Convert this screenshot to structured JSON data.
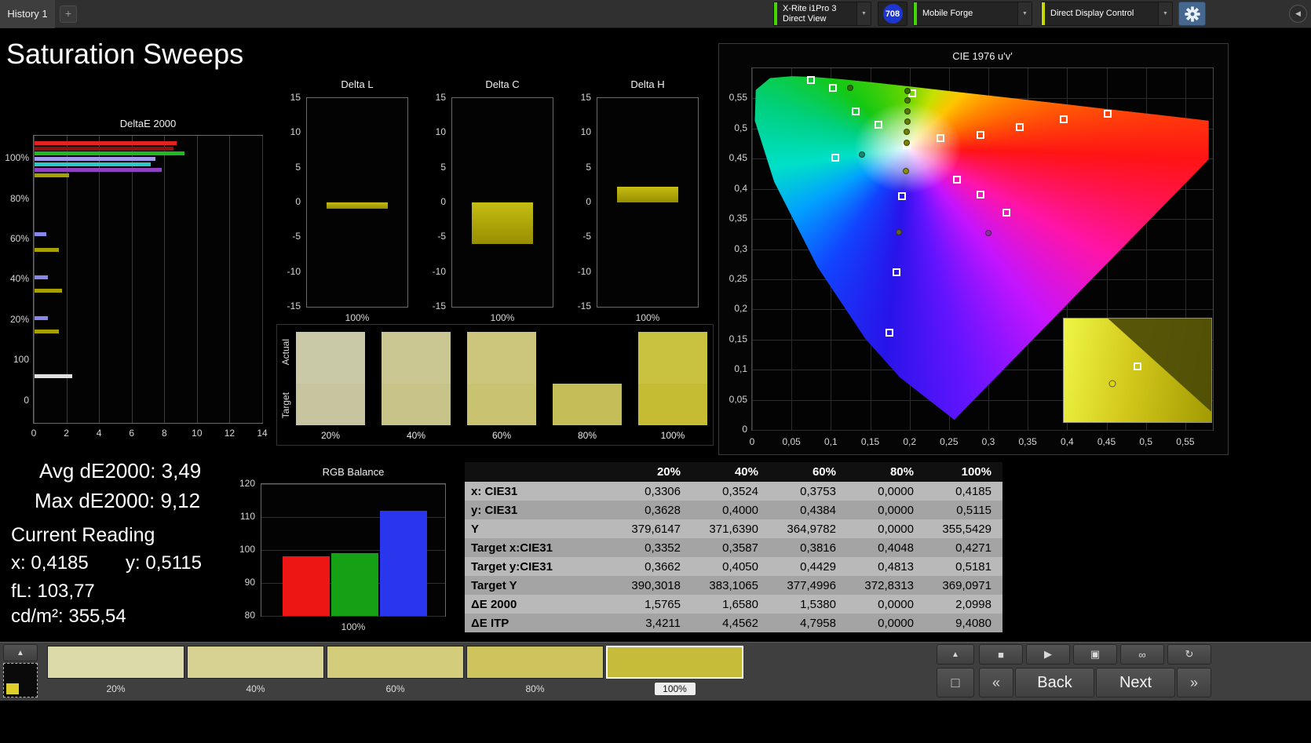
{
  "topbar": {
    "history_tab": "History 1",
    "meter": {
      "line1": "X-Rite i1Pro 3",
      "line2": "Direct View",
      "indicator_color": "#44d600"
    },
    "badge": "708",
    "badge_color": "#1c36cf",
    "source": {
      "label": "Mobile Forge",
      "indicator_color": "#44d600"
    },
    "display_control": {
      "label": "Direct Display Control",
      "indicator_color": "#c6d800"
    }
  },
  "page_title": "Saturation Sweeps",
  "readings": {
    "avg_de2000": {
      "label": "Avg dE2000:",
      "value": "3,49"
    },
    "max_de2000": {
      "label": "Max dE2000:",
      "value": "9,12"
    },
    "current_reading_label": "Current Reading",
    "x": {
      "label": "x:",
      "value": "0,4185"
    },
    "y": {
      "label": "y:",
      "value": "0,5115"
    },
    "fl": {
      "label": "fL:",
      "value": "103,77"
    },
    "cdm2": {
      "label": "cd/m²:",
      "value": "355,54"
    }
  },
  "patches": {
    "row_labels": [
      "Actual",
      "Target"
    ],
    "items": [
      {
        "label": "20%",
        "actual": "#c9c9a8",
        "target": "#c7c5a0"
      },
      {
        "label": "40%",
        "actual": "#cbc792",
        "target": "#c8c389"
      },
      {
        "label": "60%",
        "actual": "#ccc67c",
        "target": "#c9c271"
      },
      {
        "label": "80%",
        "actual": "#000000",
        "target": "#c5bd58"
      },
      {
        "label": "100%",
        "actual": "#c9c240",
        "target": "#c5bc33"
      }
    ]
  },
  "table": {
    "columns": [
      "",
      "20%",
      "40%",
      "60%",
      "80%",
      "100%"
    ],
    "rows": [
      {
        "label": "x: CIE31",
        "values": [
          "0,3306",
          "0,3524",
          "0,3753",
          "0,0000",
          "0,4185"
        ]
      },
      {
        "label": "y: CIE31",
        "values": [
          "0,3628",
          "0,4000",
          "0,4384",
          "0,0000",
          "0,5115"
        ]
      },
      {
        "label": "Y",
        "values": [
          "379,6147",
          "371,6390",
          "364,9782",
          "0,0000",
          "355,5429"
        ]
      },
      {
        "label": "Target x:CIE31",
        "values": [
          "0,3352",
          "0,3587",
          "0,3816",
          "0,4048",
          "0,4271"
        ]
      },
      {
        "label": "Target y:CIE31",
        "values": [
          "0,3662",
          "0,4050",
          "0,4429",
          "0,4813",
          "0,5181"
        ]
      },
      {
        "label": "Target Y",
        "values": [
          "390,3018",
          "383,1065",
          "377,4996",
          "372,8313",
          "369,0971"
        ]
      },
      {
        "label": "ΔE 2000",
        "values": [
          "1,5765",
          "1,6580",
          "1,5380",
          "0,0000",
          "2,0998"
        ]
      },
      {
        "label": "ΔE ITP",
        "values": [
          "3,4211",
          "4,4562",
          "4,7958",
          "0,0000",
          "9,4080"
        ]
      }
    ]
  },
  "bottom_bar": {
    "swatches": [
      {
        "label": "20%",
        "color": "#dcdaa8",
        "selected": false
      },
      {
        "label": "40%",
        "color": "#d7d292",
        "selected": false
      },
      {
        "label": "60%",
        "color": "#d2cc7b",
        "selected": false
      },
      {
        "label": "80%",
        "color": "#cdc45d",
        "selected": false
      },
      {
        "label": "100%",
        "color": "#c6bc3a",
        "selected": true
      }
    ],
    "back_label": "Back",
    "next_label": "Next"
  },
  "icons": {
    "add": "+",
    "chevron": "▼",
    "collapse": "◀",
    "up_arrow": "▲",
    "stop": "■",
    "play": "▶",
    "single_read": "▣",
    "continuous": "∞",
    "repeat": "↻",
    "prev": "«",
    "next": "»",
    "big_stop": "□"
  },
  "chart_data": [
    {
      "id": "deltae2000",
      "type": "bar",
      "orientation": "horizontal",
      "title": "DeltaE 2000",
      "xlim": [
        0,
        14
      ],
      "xticks": [
        0,
        2,
        4,
        6,
        8,
        10,
        12,
        14
      ],
      "ylabels": [
        {
          "text": "100%",
          "pos": 0.079
        },
        {
          "text": "80%",
          "pos": 0.22
        },
        {
          "text": "60%",
          "pos": 0.361
        },
        {
          "text": "40%",
          "pos": 0.5
        },
        {
          "text": "20%",
          "pos": 0.641
        },
        {
          "text": "100",
          "pos": 0.782
        },
        {
          "text": "0",
          "pos": 0.923
        }
      ],
      "bars": [
        {
          "pos": 0.018,
          "value": 8.7,
          "color": "#e42222"
        },
        {
          "pos": 0.037,
          "value": 8.5,
          "color": "#8c1212"
        },
        {
          "pos": 0.056,
          "value": 9.2,
          "color": "#22b822"
        },
        {
          "pos": 0.075,
          "value": 7.4,
          "color": "#a49aec"
        },
        {
          "pos": 0.094,
          "value": 7.1,
          "color": "#2ec8c8"
        },
        {
          "pos": 0.113,
          "value": 7.8,
          "color": "#9040c0"
        },
        {
          "pos": 0.132,
          "value": 2.1,
          "color": "#a8a000"
        },
        {
          "pos": 0.335,
          "value": 0.7,
          "color": "#8888e8"
        },
        {
          "pos": 0.392,
          "value": 1.5,
          "color": "#a8a000"
        },
        {
          "pos": 0.487,
          "value": 0.8,
          "color": "#8888e8"
        },
        {
          "pos": 0.533,
          "value": 1.7,
          "color": "#a8a000"
        },
        {
          "pos": 0.629,
          "value": 0.8,
          "color": "#8888e8"
        },
        {
          "pos": 0.676,
          "value": 1.5,
          "color": "#a8a000"
        },
        {
          "pos": 0.83,
          "value": 2.3,
          "color": "#e0e0e0"
        }
      ]
    },
    {
      "id": "delta_l",
      "type": "bar",
      "title": "Delta L",
      "ylim": [
        -15,
        15
      ],
      "yticks": [
        15,
        10,
        5,
        0,
        -5,
        -10,
        -15
      ],
      "value": -0.9,
      "xlabel": "100%",
      "bar_color": "#b4ad08"
    },
    {
      "id": "delta_c",
      "type": "bar",
      "title": "Delta C",
      "ylim": [
        -15,
        15
      ],
      "yticks": [
        15,
        10,
        5,
        0,
        -5,
        -10,
        -15
      ],
      "value": -6.0,
      "xlabel": "100%",
      "bar_color": "#b4ad08"
    },
    {
      "id": "delta_h",
      "type": "bar",
      "title": "Delta H",
      "ylim": [
        -15,
        15
      ],
      "yticks": [
        15,
        10,
        5,
        0,
        -5,
        -10,
        -15
      ],
      "value": 2.3,
      "xlabel": "100%",
      "bar_color": "#b4ad08"
    },
    {
      "id": "rgb_balance",
      "type": "bar",
      "title": "RGB Balance",
      "ylim": [
        80,
        120
      ],
      "yticks": [
        120,
        110,
        100,
        90,
        80
      ],
      "xlabel": "100%",
      "series": [
        {
          "name": "Red",
          "value": 98,
          "color": "#ee1515"
        },
        {
          "name": "Green",
          "value": 99,
          "color": "#15a015"
        },
        {
          "name": "Blue",
          "value": 112,
          "color": "#2a35ee"
        }
      ]
    },
    {
      "id": "cie_diagram",
      "type": "scatter",
      "title": "CIE 1976 u'v'",
      "xlim": [
        0,
        0.585
      ],
      "ylim": [
        0,
        0.6
      ],
      "xticks": [
        "0",
        "0,05",
        "0,1",
        "0,15",
        "0,2",
        "0,25",
        "0,3",
        "0,35",
        "0,4",
        "0,45",
        "0,5",
        "0,55"
      ],
      "yticks": [
        "0",
        "0,05",
        "0,1",
        "0,15",
        "0,2",
        "0,25",
        "0,3",
        "0,35",
        "0,4",
        "0,45",
        "0,5",
        "0,55"
      ],
      "targets": [
        [
          0.075,
          0.58
        ],
        [
          0.103,
          0.568
        ],
        [
          0.132,
          0.528
        ],
        [
          0.16,
          0.506
        ],
        [
          0.106,
          0.451
        ],
        [
          0.196,
          0.472
        ],
        [
          0.203,
          0.558
        ],
        [
          0.239,
          0.484
        ],
        [
          0.29,
          0.49
        ],
        [
          0.34,
          0.503
        ],
        [
          0.396,
          0.516
        ],
        [
          0.451,
          0.525
        ],
        [
          0.26,
          0.415
        ],
        [
          0.29,
          0.39
        ],
        [
          0.323,
          0.36
        ],
        [
          0.19,
          0.388
        ],
        [
          0.183,
          0.262
        ],
        [
          0.174,
          0.162
        ]
      ],
      "measurements": [
        [
          0.125,
          0.568,
          "#2e6e00"
        ],
        [
          0.197,
          0.562,
          "#3c7000"
        ],
        [
          0.197,
          0.546,
          "#4c7400"
        ],
        [
          0.197,
          0.529,
          "#5a7800"
        ],
        [
          0.197,
          0.512,
          "#667c00"
        ],
        [
          0.196,
          0.494,
          "#728000"
        ],
        [
          0.196,
          0.476,
          "#7e8400"
        ],
        [
          0.14,
          0.457,
          "#108a70"
        ],
        [
          0.195,
          0.429,
          "#8a8a10"
        ],
        [
          0.186,
          0.328,
          "#62622a"
        ],
        [
          0.3,
          0.327,
          "#8a30a0"
        ]
      ],
      "inset": {
        "square": [
          0.5,
          0.46
        ],
        "dot": [
          0.33,
          0.63
        ]
      }
    }
  ]
}
